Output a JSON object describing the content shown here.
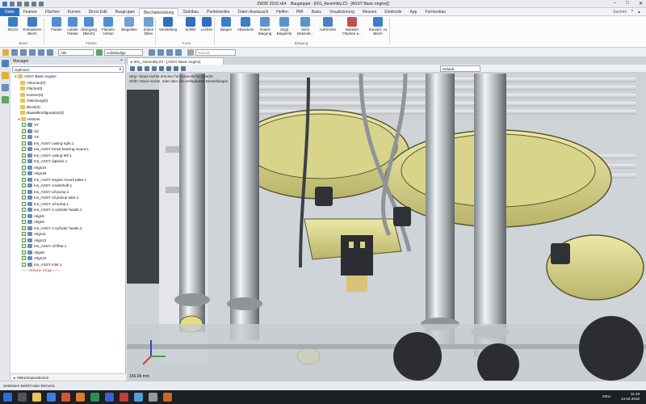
{
  "window": {
    "title": "ZW3D 2016 x64",
    "doc_title": "Baugruppe - [001_Assembly.Z3 - [ASSY Basic engine]]"
  },
  "menu": {
    "items": [
      "Datei",
      "Feature",
      "Flächen",
      "Kurven",
      "Direct Edit",
      "Baugruppe",
      "Blechabwicklung",
      "Stahlbau",
      "Punktewolke",
      "Daten Austausch",
      "Helfen",
      "PMI",
      "Basis",
      "Visualisierung",
      "Messen",
      "Elektrode",
      "App",
      "Formenbau"
    ],
    "right": [
      "Suchen",
      "?",
      "▲"
    ]
  },
  "ribbon": {
    "buttons": [
      "Skizze",
      "Extrudieren Blech",
      "Flanke",
      "Lokale Flanke",
      "Übergang (Blech)",
      "Flanken ziehen",
      "Biegelinie",
      "Ecken füllen",
      "Verstellung",
      "Schlitz",
      "Lochen",
      "Biegen",
      "Abwickeln",
      "Ändert Biegung",
      "Zeigt Biegeinfo",
      "Setzt stationär...",
      "Aufrennen",
      "Markiert Flächen a...",
      "Konvert. zu Blech"
    ],
    "groups": [
      "Basis",
      "Flanke",
      "Form",
      "Biegung"
    ]
  },
  "toolbar2": {
    "filter": "Alle",
    "mode": "vollständige Baugrupp",
    "style": "Normal"
  },
  "manager": {
    "title": "Manager",
    "dropdown": "Optimiert",
    "tree": [
      {
        "text": "ASSY Basic engine",
        "kind": "root"
      },
      {
        "text": "Volumen(0)",
        "kind": "folder"
      },
      {
        "text": "Fläche(0)",
        "kind": "folder"
      },
      {
        "text": "Kurven(0)",
        "kind": "folder"
      },
      {
        "text": "Gleichung(0)",
        "kind": "folder"
      },
      {
        "text": "Block(0)",
        "kind": "folder"
      },
      {
        "text": "Bauteilkonfiguration(0)",
        "kind": "folder"
      },
      {
        "text": "Historie",
        "kind": "hist"
      },
      {
        "text": "XY",
        "kind": "item"
      },
      {
        "text": "XZ",
        "kind": "item"
      },
      {
        "text": "YZ",
        "kind": "item"
      },
      {
        "text": "Ins_ASSY casing right.1",
        "kind": "item"
      },
      {
        "text": "Ins_ASSY thrust bearing mount.1",
        "kind": "item"
      },
      {
        "text": "Ins_ASSY casing left.1",
        "kind": "item"
      },
      {
        "text": "Ins_ASSY dipstick.1",
        "kind": "item"
      },
      {
        "text": "Align24",
        "kind": "item"
      },
      {
        "text": "Align25",
        "kind": "item"
      },
      {
        "text": "Ins_ASSY engine mount plate.1",
        "kind": "item"
      },
      {
        "text": "Ins_ASSY crankshaft.1",
        "kind": "item"
      },
      {
        "text": "Ins_ASSY oil pump.1",
        "kind": "item"
      },
      {
        "text": "Ins_ASSY oil pickup tube.1",
        "kind": "item"
      },
      {
        "text": "Ins_ASSY oil sump.1",
        "kind": "item"
      },
      {
        "text": "Ins_ASSY 2 cylinder heads.1",
        "kind": "item"
      },
      {
        "text": "Align5",
        "kind": "item"
      },
      {
        "text": "Align6",
        "kind": "item"
      },
      {
        "text": "Ins_ASSY 2 cylinder heads.2",
        "kind": "item"
      },
      {
        "text": "Align11",
        "kind": "item"
      },
      {
        "text": "Align12",
        "kind": "item"
      },
      {
        "text": "Ins_ASSY oil filter.1",
        "kind": "item"
      },
      {
        "text": "Align9",
        "kind": "item"
      },
      {
        "text": "Align10",
        "kind": "item"
      },
      {
        "text": "Ins_ASSY inlet.1",
        "kind": "item"
      },
      {
        "text": "----- Historie Stopp -----",
        "kind": "stop"
      }
    ],
    "history_ops": "Historieoperationen"
  },
  "viewport": {
    "tab": "001_Assembly.Z3 - [ASSY Basic engine]",
    "view": "Default",
    "hint1": "Strg+ Maus rechts drücken für dynamische Ansicht",
    "hint2": "Shift+ Maus rechts, oder über die verfügbaren Einstellungen",
    "scale": "156.06 mm",
    "colors": {
      "cylinder": "#d8d48a",
      "fin": "#dfe2e4",
      "steel": "#b8bcc0",
      "background": "#cfd4d8"
    }
  },
  "status": {
    "text": "Selektiere Befehl oder Element."
  },
  "taskbar": {
    "time": "11:19",
    "date": "14.04.2016",
    "lang": "DEU"
  }
}
